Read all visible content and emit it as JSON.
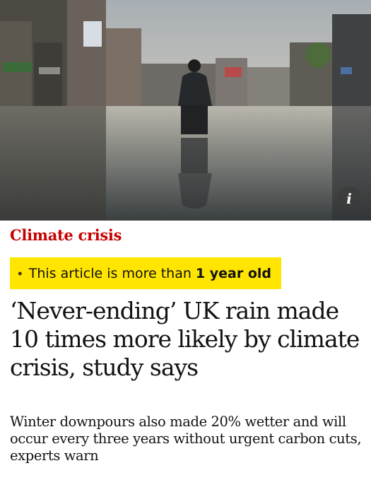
{
  "hero": {
    "image_description": "Man standing in a flooded town street with shopfronts reflected in the water",
    "info_button_label": "i"
  },
  "kicker": "Climate crisis",
  "age_notice": {
    "icon": "clock-icon",
    "text": "This article is more than",
    "emphasis": "1 year old",
    "background_color": "#ffe500"
  },
  "headline": "‘Never-ending’ UK rain made 10 times more likely by climate crisis, study says",
  "standfirst": "Winter downpours also made 20% wetter and will occur every three years without urgent carbon cuts, experts warn",
  "colors": {
    "kicker": "#c70000",
    "text": "#121212"
  }
}
